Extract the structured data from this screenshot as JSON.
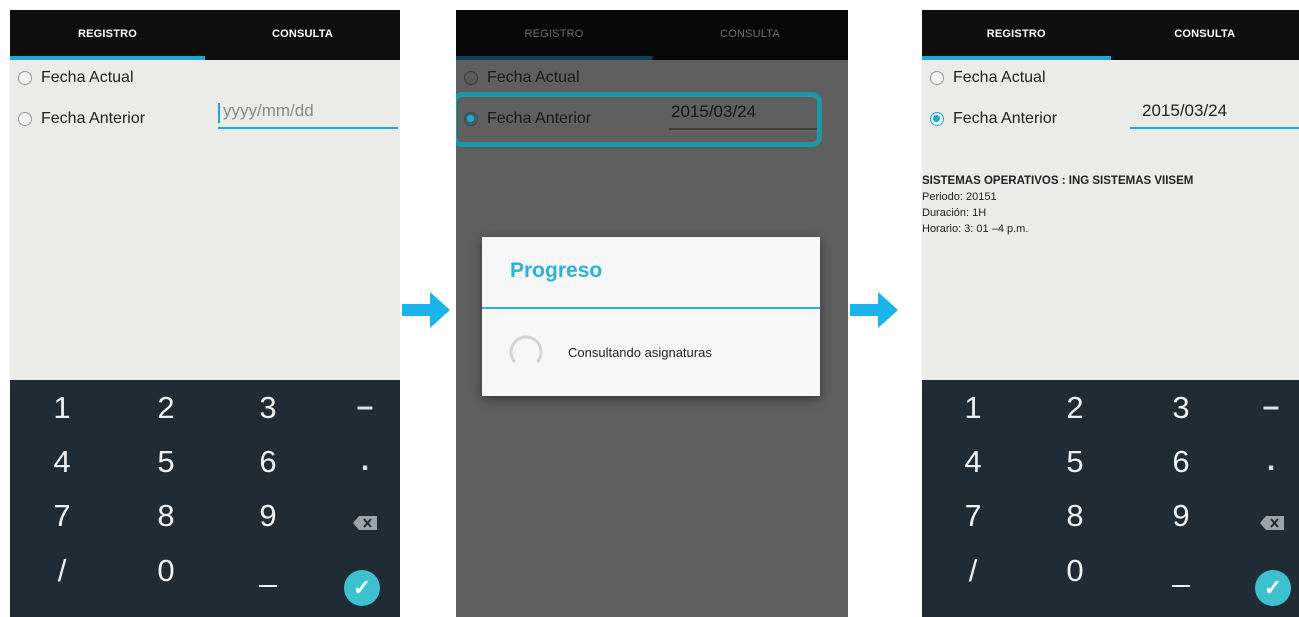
{
  "tabs": {
    "registro": "REGISTRO",
    "consulta": "CONSULTA"
  },
  "form": {
    "fecha_actual": "Fecha Actual",
    "fecha_anterior": "Fecha Anterior",
    "date_placeholder": "yyyy/mm/dd",
    "date_value": "2015/03/24"
  },
  "keypad": {
    "rows": [
      [
        "1",
        "2",
        "3",
        "–"
      ],
      [
        "4",
        "5",
        "6",
        "."
      ],
      [
        "7",
        "8",
        "9",
        "⌫"
      ],
      [
        "/",
        "0",
        "_",
        "✓"
      ]
    ]
  },
  "dialog": {
    "title": "Progreso",
    "message": "Consultando asignaturas"
  },
  "result": {
    "course": "SISTEMAS OPERATIVOS : ING SISTEMAS VIISEM",
    "periodo": "Periodo: 20151",
    "duracion": "Duración: 1H",
    "horario": "Horario: 3: 01 –4 p.m."
  },
  "colors": {
    "accent": "#1ca9d6",
    "keypad_bg": "#1f2c35",
    "confirm": "#3cc1ce"
  },
  "icons": [
    "radio-icon",
    "backspace-icon",
    "check-icon",
    "spinner-icon",
    "arrow-right-icon"
  ]
}
